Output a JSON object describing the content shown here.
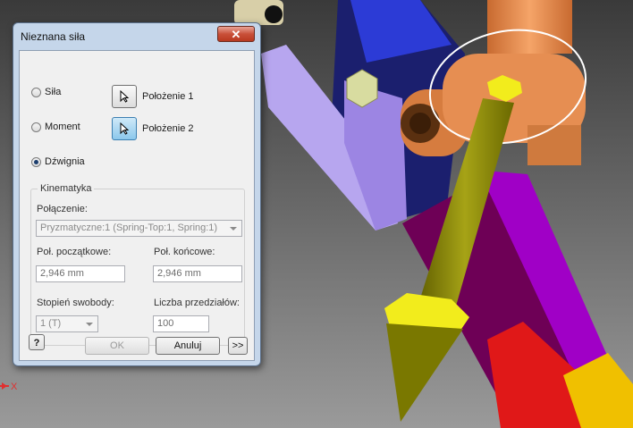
{
  "dialog": {
    "title": "Nieznana siła",
    "close_symbol": "✕"
  },
  "options": {
    "sila": "Siła",
    "moment": "Moment",
    "dzwignia": "Dźwignia",
    "selected": "dzwignia"
  },
  "selectors": {
    "polozenie1": "Położenie 1",
    "polozenie2": "Położenie 2",
    "active": "polozenie2"
  },
  "kinematics": {
    "group_title": "Kinematyka",
    "polaczenie_label": "Połączenie:",
    "polaczenie_value": "Pryzmatyczne:1 (Spring-Top:1, Spring:1)",
    "start_label": "Poł. początkowe:",
    "start_value": "2,946 mm",
    "end_label": "Poł. końcowe:",
    "end_value": "2,946 mm",
    "dof_label": "Stopień swobody:",
    "dof_value": "1 (T)",
    "intervals_label": "Liczba przedziałów:",
    "intervals_value": "100"
  },
  "buttons": {
    "help": "?",
    "ok": "OK",
    "cancel": "Anuluj",
    "more": ">>"
  },
  "axis_label": "X",
  "colors": {
    "accent_blue": "#3c7fb1",
    "close_red": "#c9513a",
    "rod_olive": "#8c8a00",
    "part_orange": "#f29a5a",
    "bracket_purple": "#9a6fe0",
    "bar_magenta": "#a100c8"
  },
  "icons": {
    "cursor": "arrow-cursor-icon",
    "help": "question-mark-icon"
  }
}
